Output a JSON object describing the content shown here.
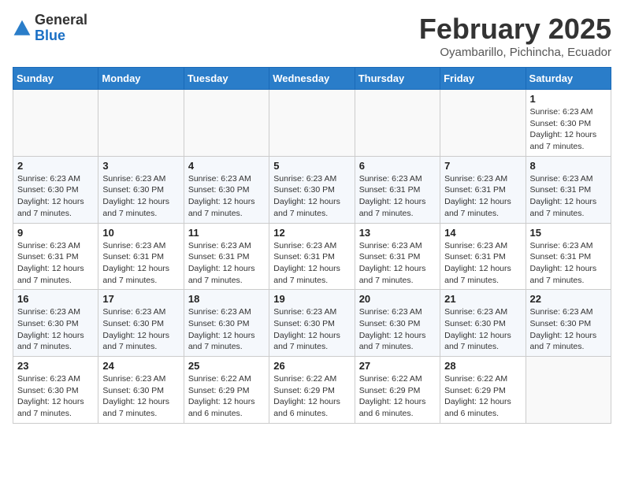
{
  "header": {
    "logo_general": "General",
    "logo_blue": "Blue",
    "month_title": "February 2025",
    "subtitle": "Oyambarillo, Pichincha, Ecuador"
  },
  "days_of_week": [
    "Sunday",
    "Monday",
    "Tuesday",
    "Wednesday",
    "Thursday",
    "Friday",
    "Saturday"
  ],
  "weeks": [
    [
      {
        "day": "",
        "content": ""
      },
      {
        "day": "",
        "content": ""
      },
      {
        "day": "",
        "content": ""
      },
      {
        "day": "",
        "content": ""
      },
      {
        "day": "",
        "content": ""
      },
      {
        "day": "",
        "content": ""
      },
      {
        "day": "1",
        "content": "Sunrise: 6:23 AM\nSunset: 6:30 PM\nDaylight: 12 hours and 7 minutes."
      }
    ],
    [
      {
        "day": "2",
        "content": "Sunrise: 6:23 AM\nSunset: 6:30 PM\nDaylight: 12 hours and 7 minutes."
      },
      {
        "day": "3",
        "content": "Sunrise: 6:23 AM\nSunset: 6:30 PM\nDaylight: 12 hours and 7 minutes."
      },
      {
        "day": "4",
        "content": "Sunrise: 6:23 AM\nSunset: 6:30 PM\nDaylight: 12 hours and 7 minutes."
      },
      {
        "day": "5",
        "content": "Sunrise: 6:23 AM\nSunset: 6:30 PM\nDaylight: 12 hours and 7 minutes."
      },
      {
        "day": "6",
        "content": "Sunrise: 6:23 AM\nSunset: 6:31 PM\nDaylight: 12 hours and 7 minutes."
      },
      {
        "day": "7",
        "content": "Sunrise: 6:23 AM\nSunset: 6:31 PM\nDaylight: 12 hours and 7 minutes."
      },
      {
        "day": "8",
        "content": "Sunrise: 6:23 AM\nSunset: 6:31 PM\nDaylight: 12 hours and 7 minutes."
      }
    ],
    [
      {
        "day": "9",
        "content": "Sunrise: 6:23 AM\nSunset: 6:31 PM\nDaylight: 12 hours and 7 minutes."
      },
      {
        "day": "10",
        "content": "Sunrise: 6:23 AM\nSunset: 6:31 PM\nDaylight: 12 hours and 7 minutes."
      },
      {
        "day": "11",
        "content": "Sunrise: 6:23 AM\nSunset: 6:31 PM\nDaylight: 12 hours and 7 minutes."
      },
      {
        "day": "12",
        "content": "Sunrise: 6:23 AM\nSunset: 6:31 PM\nDaylight: 12 hours and 7 minutes."
      },
      {
        "day": "13",
        "content": "Sunrise: 6:23 AM\nSunset: 6:31 PM\nDaylight: 12 hours and 7 minutes."
      },
      {
        "day": "14",
        "content": "Sunrise: 6:23 AM\nSunset: 6:31 PM\nDaylight: 12 hours and 7 minutes."
      },
      {
        "day": "15",
        "content": "Sunrise: 6:23 AM\nSunset: 6:31 PM\nDaylight: 12 hours and 7 minutes."
      }
    ],
    [
      {
        "day": "16",
        "content": "Sunrise: 6:23 AM\nSunset: 6:30 PM\nDaylight: 12 hours and 7 minutes."
      },
      {
        "day": "17",
        "content": "Sunrise: 6:23 AM\nSunset: 6:30 PM\nDaylight: 12 hours and 7 minutes."
      },
      {
        "day": "18",
        "content": "Sunrise: 6:23 AM\nSunset: 6:30 PM\nDaylight: 12 hours and 7 minutes."
      },
      {
        "day": "19",
        "content": "Sunrise: 6:23 AM\nSunset: 6:30 PM\nDaylight: 12 hours and 7 minutes."
      },
      {
        "day": "20",
        "content": "Sunrise: 6:23 AM\nSunset: 6:30 PM\nDaylight: 12 hours and 7 minutes."
      },
      {
        "day": "21",
        "content": "Sunrise: 6:23 AM\nSunset: 6:30 PM\nDaylight: 12 hours and 7 minutes."
      },
      {
        "day": "22",
        "content": "Sunrise: 6:23 AM\nSunset: 6:30 PM\nDaylight: 12 hours and 7 minutes."
      }
    ],
    [
      {
        "day": "23",
        "content": "Sunrise: 6:23 AM\nSunset: 6:30 PM\nDaylight: 12 hours and 7 minutes."
      },
      {
        "day": "24",
        "content": "Sunrise: 6:23 AM\nSunset: 6:30 PM\nDaylight: 12 hours and 7 minutes."
      },
      {
        "day": "25",
        "content": "Sunrise: 6:22 AM\nSunset: 6:29 PM\nDaylight: 12 hours and 6 minutes."
      },
      {
        "day": "26",
        "content": "Sunrise: 6:22 AM\nSunset: 6:29 PM\nDaylight: 12 hours and 6 minutes."
      },
      {
        "day": "27",
        "content": "Sunrise: 6:22 AM\nSunset: 6:29 PM\nDaylight: 12 hours and 6 minutes."
      },
      {
        "day": "28",
        "content": "Sunrise: 6:22 AM\nSunset: 6:29 PM\nDaylight: 12 hours and 6 minutes."
      },
      {
        "day": "",
        "content": ""
      }
    ]
  ]
}
